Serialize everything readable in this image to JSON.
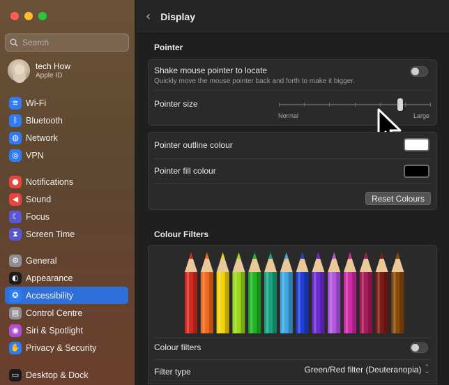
{
  "sidebar": {
    "search_placeholder": "Search",
    "account": {
      "name": "tech How",
      "subtitle": "Apple ID"
    },
    "groups": [
      [
        {
          "label": "Wi-Fi",
          "icon": "wifi-icon",
          "color": "#2f7cf6",
          "glyph": "≋"
        },
        {
          "label": "Bluetooth",
          "icon": "bluetooth-icon",
          "color": "#2f7cf6",
          "glyph": "ᛒ"
        },
        {
          "label": "Network",
          "icon": "globe-icon",
          "color": "#2f7cf6",
          "glyph": "◍"
        },
        {
          "label": "VPN",
          "icon": "vpn-icon",
          "color": "#2f7cf6",
          "glyph": "◎"
        }
      ],
      [
        {
          "label": "Notifications",
          "icon": "bell-icon",
          "color": "#e8453c",
          "glyph": "●"
        },
        {
          "label": "Sound",
          "icon": "speaker-icon",
          "color": "#e8453c",
          "glyph": "◀"
        },
        {
          "label": "Focus",
          "icon": "moon-icon",
          "color": "#5a57d6",
          "glyph": "☾"
        },
        {
          "label": "Screen Time",
          "icon": "hourglass-icon",
          "color": "#5a57d6",
          "glyph": "⧗"
        }
      ],
      [
        {
          "label": "General",
          "icon": "gear-icon",
          "color": "#8e8e93",
          "glyph": "⚙"
        },
        {
          "label": "Appearance",
          "icon": "appearance-icon",
          "color": "#1c1c1c",
          "glyph": "◐"
        },
        {
          "label": "Accessibility",
          "icon": "accessibility-icon",
          "color": "#2f7cf6",
          "glyph": "✪",
          "selected": true
        },
        {
          "label": "Control Centre",
          "icon": "control-centre-icon",
          "color": "#8e8e93",
          "glyph": "▤"
        },
        {
          "label": "Siri & Spotlight",
          "icon": "siri-icon",
          "color": "#b34dd8",
          "glyph": "◉"
        },
        {
          "label": "Privacy & Security",
          "icon": "hand-icon",
          "color": "#2f7cf6",
          "glyph": "✋"
        }
      ],
      [
        {
          "label": "Desktop & Dock",
          "icon": "dock-icon",
          "color": "#1c1c1c",
          "glyph": "▭"
        }
      ]
    ]
  },
  "main": {
    "title": "Display",
    "pointer": {
      "section_title": "Pointer",
      "shake_label": "Shake mouse pointer to locate",
      "shake_desc": "Quickly move the mouse pointer back and forth to make it bigger.",
      "shake_enabled": false,
      "size_label": "Pointer size",
      "size_min_label": "Normal",
      "size_max_label": "Large",
      "size_value": 0.8,
      "outline_label": "Pointer outline colour",
      "outline_color": "#ffffff",
      "fill_label": "Pointer fill colour",
      "fill_color": "#000000",
      "reset_label": "Reset Colours"
    },
    "colour_filters": {
      "section_title": "Colour Filters",
      "pencils": [
        "#d42a22",
        "#ef6a1c",
        "#f2d40c",
        "#9ad818",
        "#22b325",
        "#17a37e",
        "#3fa6df",
        "#1f3fd6",
        "#6a2ad0",
        "#b357de",
        "#d12aa8",
        "#a81b5a",
        "#7e1b16",
        "#8a4a0c"
      ],
      "filters_label": "Colour filters",
      "filters_enabled": false,
      "filter_type_label": "Filter type",
      "filter_type_value": "Green/Red filter (Deuteranopia)"
    }
  }
}
